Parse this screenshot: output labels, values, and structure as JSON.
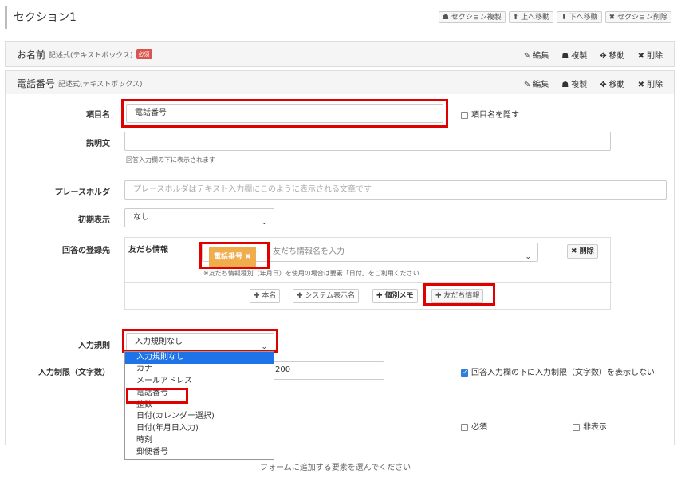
{
  "section": {
    "title": "セクション1",
    "actions": [
      "☗ セクション複製",
      "⬆ 上へ移動",
      "⬇ 下へ移動",
      "✖ セクション削除"
    ]
  },
  "item_name_panel": {
    "title": "お名前",
    "type": "記述式(テキストボックス)",
    "badge": "必須",
    "actions": [
      "編集",
      "複製",
      "移動",
      "削除"
    ]
  },
  "phone_panel": {
    "title": "電話番号",
    "type": "記述式(テキストボックス)",
    "actions": [
      "編集",
      "複製",
      "移動",
      "削除"
    ]
  },
  "form": {
    "item_name_label": "項目名",
    "item_name_value": "電話番号",
    "hide_name_label": "項目名を隠す",
    "description_label": "説明文",
    "description_hint": "回答入力欄の下に表示されます",
    "placeholder_label": "プレースホルダ",
    "placeholder_placeholder": "プレースホルダはテキスト入力欄にこのように表示される文章です",
    "initial_label": "初期表示",
    "initial_value": "なし",
    "answer_dest_label": "回答の登録先",
    "friend_info_label": "友だち情報",
    "tag_label": "電話番号 ✖",
    "friend_info_placeholder": "友だち情報名を入力",
    "friend_info_note": "※友だち情報種別（年月日）を使用の場合は要素「日付」をご利用ください",
    "delete_label": "✖ 削除",
    "add_buttons": [
      "✚ 本名",
      "✚ システム表示名",
      "✚ 個別メモ",
      "✚ 友だち情報"
    ],
    "input_rule_label": "入力規則",
    "input_rule_value": "入力規則なし",
    "limit_label": "入力制限（文字数）",
    "limit_value": "200",
    "limit_hide_label": "回答入力欄の下に入力制限（文字数）を表示しない",
    "required_label": "必須",
    "hidden_label": "非表示"
  },
  "dropdown_options": [
    "入力規則なし",
    "カナ",
    "メールアドレス",
    "電話番号",
    "整数",
    "日付(カレンダー選択)",
    "日付(年月日入力)",
    "時刻",
    "郵便番号"
  ],
  "footer_text": "フォームに追加する要素を選んでください"
}
